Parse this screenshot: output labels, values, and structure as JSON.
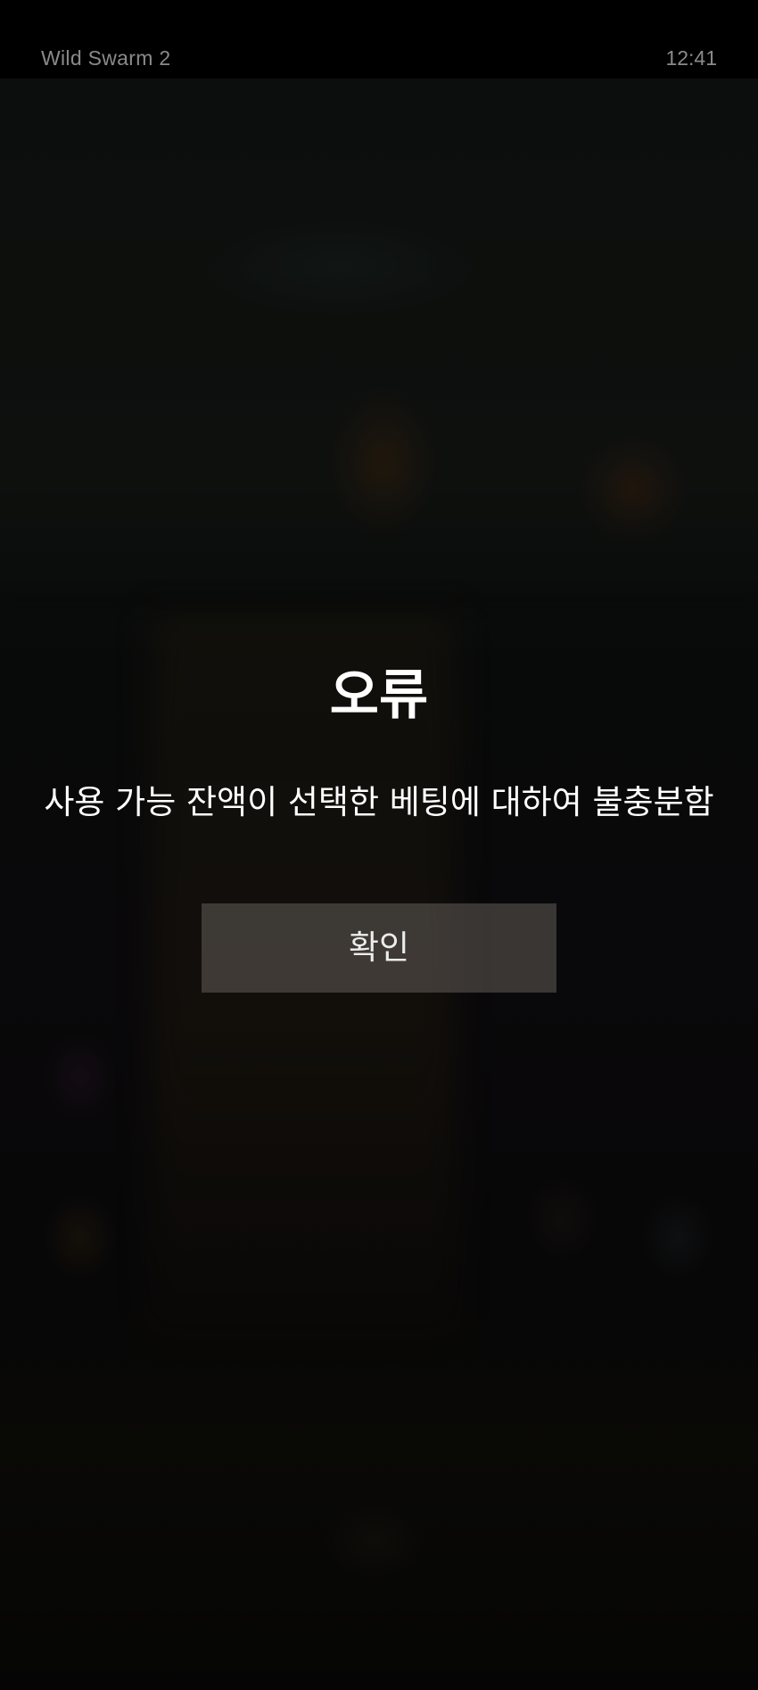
{
  "status_bar": {
    "app_title": "Wild Swarm 2",
    "time": "12:41"
  },
  "dialog": {
    "title": "오류",
    "message": "사용 가능 잔액이 선택한 베팅에 대하여 불충분함",
    "confirm_label": "확인"
  },
  "colors": {
    "status_bar_bg": "#000000",
    "status_text": "#8a8a8a",
    "dialog_text": "#ffffff",
    "button_bg": "#6e6862"
  }
}
